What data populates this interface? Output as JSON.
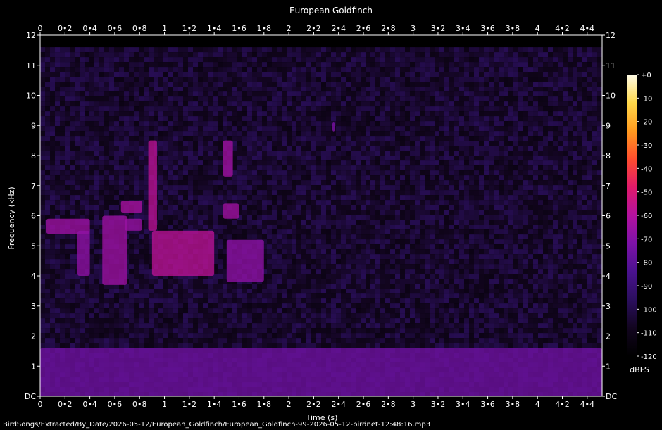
{
  "chart_data": {
    "type": "heatmap",
    "title": "European Goldfinch",
    "xlabel": "Time (s)",
    "ylabel": "Frequency (kHz)",
    "x_ticks": [
      "0",
      "0•2",
      "0•4",
      "0•6",
      "0•8",
      "1",
      "1•2",
      "1•4",
      "1•6",
      "1•8",
      "2",
      "2•2",
      "2•4",
      "2•6",
      "2•8",
      "3",
      "3•2",
      "3•4",
      "3•6",
      "3•8",
      "4",
      "4•2",
      "4•4"
    ],
    "y_ticks": [
      "DC",
      "1",
      "2",
      "3",
      "4",
      "5",
      "6",
      "7",
      "8",
      "9",
      "10",
      "11",
      "12"
    ],
    "xlim": [
      0,
      4.52
    ],
    "ylim": [
      0,
      12
    ],
    "colorbar": {
      "ticks": [
        "+0",
        "-10",
        "-20",
        "-30",
        "-40",
        "-50",
        "-60",
        "-70",
        "-80",
        "-90",
        "-100",
        "-110",
        "-120"
      ],
      "range": [
        -120,
        0
      ],
      "unit": "dBFS"
    },
    "signal_events": [
      {
        "t_start": 0.05,
        "t_end": 0.4,
        "f_low": 5.4,
        "f_high": 5.9,
        "level": -65
      },
      {
        "t_start": 0.3,
        "t_end": 0.4,
        "f_low": 4.0,
        "f_high": 5.5,
        "level": -68
      },
      {
        "t_start": 0.5,
        "t_end": 0.7,
        "f_low": 3.7,
        "f_high": 6.0,
        "level": -65
      },
      {
        "t_start": 0.65,
        "t_end": 0.82,
        "f_low": 6.1,
        "f_high": 6.5,
        "level": -62
      },
      {
        "t_start": 0.68,
        "t_end": 0.82,
        "f_low": 5.5,
        "f_high": 5.9,
        "level": -66
      },
      {
        "t_start": 0.87,
        "t_end": 0.94,
        "f_low": 5.5,
        "f_high": 8.5,
        "level": -58
      },
      {
        "t_start": 0.9,
        "t_end": 1.4,
        "f_low": 4.0,
        "f_high": 5.5,
        "level": -58
      },
      {
        "t_start": 1.47,
        "t_end": 1.55,
        "f_low": 7.3,
        "f_high": 8.5,
        "level": -64
      },
      {
        "t_start": 1.47,
        "t_end": 1.6,
        "f_low": 5.9,
        "f_high": 6.4,
        "level": -64
      },
      {
        "t_start": 1.5,
        "t_end": 1.8,
        "f_low": 3.8,
        "f_high": 5.2,
        "level": -68
      },
      {
        "t_start": 2.35,
        "t_end": 2.37,
        "f_low": 8.8,
        "f_high": 9.1,
        "level": -72
      },
      {
        "t_start": 0,
        "t_end": 4.52,
        "f_low": 0,
        "f_high": 1.6,
        "level": -75
      }
    ],
    "noise_floor_db": -105
  },
  "footer": {
    "file_path": "BirdSongs/Extracted/By_Date/2026-05-12/European_Goldfinch/European_Goldfinch-99-2026-05-12-birdnet-12:48:16.mp3"
  },
  "colors": {
    "background": "#000000",
    "text": "#ffffff",
    "colormap": [
      "#000000",
      "#12051f",
      "#2b0f5e",
      "#4a128f",
      "#7d12a8",
      "#b3129e",
      "#e01a6a",
      "#ff4d2e",
      "#ff9a1f",
      "#ffd84a",
      "#fffce8"
    ]
  }
}
